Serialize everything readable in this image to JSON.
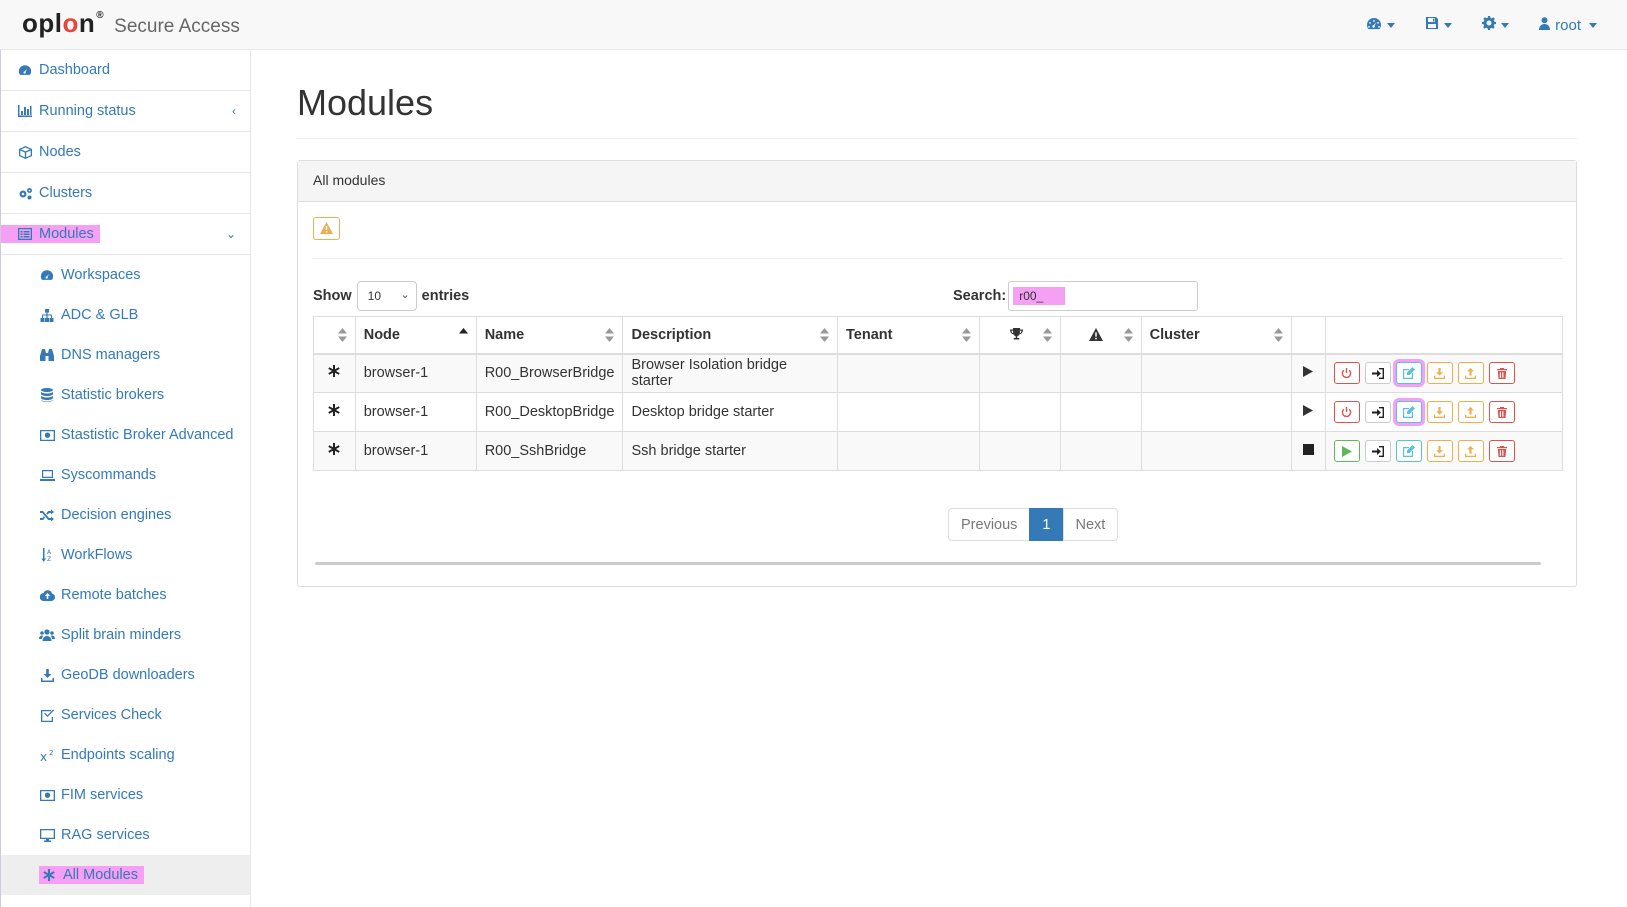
{
  "header": {
    "brand_logo": "oplon",
    "brand_sub": "Secure Access",
    "user_menu": "root",
    "icons": [
      "dashboard-icon",
      "save-icon",
      "gear-icon",
      "user-icon"
    ]
  },
  "sidebar": {
    "items": [
      {
        "label": "Dashboard",
        "icon": "dashboard-icon"
      },
      {
        "label": "Running status",
        "icon": "bar-chart-icon",
        "chevron": "‹"
      },
      {
        "label": "Nodes",
        "icon": "cube-icon"
      },
      {
        "label": "Clusters",
        "icon": "gears-icon"
      },
      {
        "label": "Modules",
        "icon": "list-alt-icon",
        "chevron": "⌄"
      }
    ],
    "subitems": [
      {
        "label": "Workspaces",
        "icon": "dashboard-icon"
      },
      {
        "label": "ADC & GLB",
        "icon": "sitemap-icon"
      },
      {
        "label": "DNS managers",
        "icon": "binoculars-icon"
      },
      {
        "label": "Statistic brokers",
        "icon": "database-icon"
      },
      {
        "label": "Stastistic Broker Advanced",
        "icon": "camera-icon"
      },
      {
        "label": "Syscommands",
        "icon": "laptop-icon"
      },
      {
        "label": "Decision engines",
        "icon": "random-icon"
      },
      {
        "label": "WorkFlows",
        "icon": "sort-alpha-icon"
      },
      {
        "label": "Remote batches",
        "icon": "cloud-upload-icon"
      },
      {
        "label": "Split brain minders",
        "icon": "users-icon"
      },
      {
        "label": "GeoDB downloaders",
        "icon": "download-icon"
      },
      {
        "label": "Services Check",
        "icon": "check-square-icon"
      },
      {
        "label": "Endpoints scaling",
        "icon": "superscript-icon"
      },
      {
        "label": "FIM services",
        "icon": "camera-icon"
      },
      {
        "label": "RAG services",
        "icon": "desktop-icon"
      },
      {
        "label": "All Modules",
        "icon": "asterisk-icon"
      }
    ]
  },
  "main": {
    "title": "Modules",
    "panel_title": "All modules",
    "show_label": "Show",
    "entries_value": "10",
    "entries_label": "entries",
    "search_label": "Search:",
    "search_value": "r00_",
    "columns": [
      "",
      "Node",
      "Name",
      "Description",
      "Tenant",
      "",
      "",
      "Cluster",
      "",
      ""
    ],
    "rows": [
      {
        "node": "browser-1",
        "name": "R00_BrowserBridge",
        "description": "Browser Isolation bridge starter",
        "tenant": "",
        "cluster": "",
        "state": "running"
      },
      {
        "node": "browser-1",
        "name": "R00_DesktopBridge",
        "description": "Desktop bridge starter",
        "tenant": "",
        "cluster": "",
        "state": "running"
      },
      {
        "node": "browser-1",
        "name": "R00_SshBridge",
        "description": "Ssh bridge starter",
        "tenant": "",
        "cluster": "",
        "state": "stopped"
      }
    ],
    "pagination": {
      "previous": "Previous",
      "current": "1",
      "next": "Next"
    }
  },
  "colors": {
    "link": "#337ab7",
    "danger": "#d9534f",
    "warning": "#f0ad4e",
    "info": "#5bc0de",
    "success": "#5cb85c",
    "highlight": "#f59ff5"
  }
}
